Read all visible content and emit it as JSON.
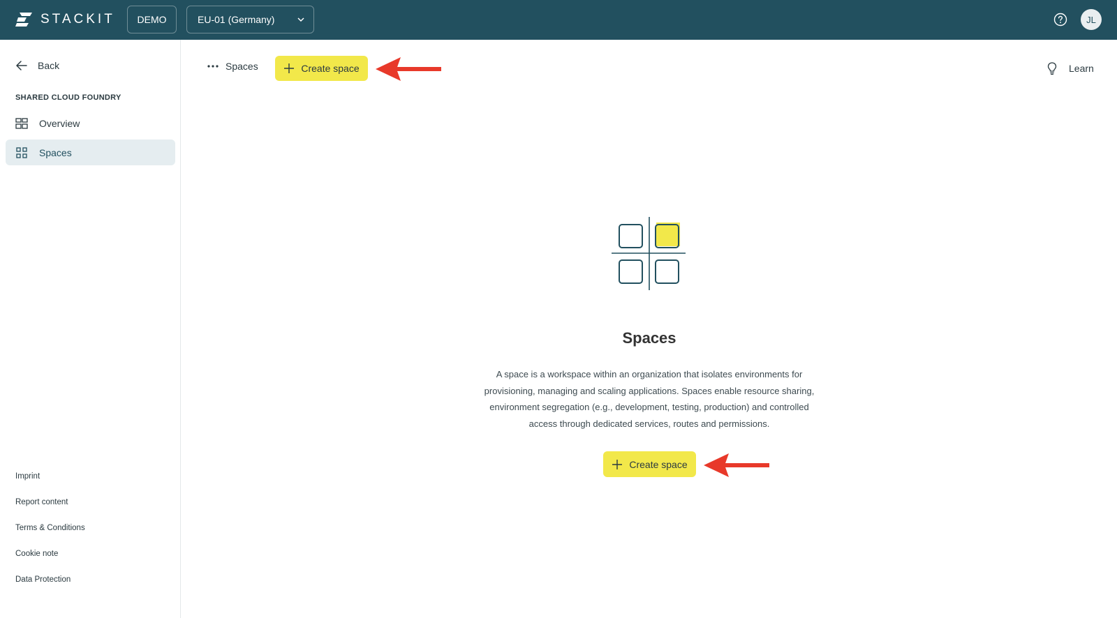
{
  "topbar": {
    "logo_text": "STACKIT",
    "org_label": "DEMO",
    "region_label": "EU-01 (Germany)",
    "help_icon": "help-circle-icon",
    "avatar_initials": "JL"
  },
  "sidebar": {
    "back_label": "Back",
    "section_title": "SHARED CLOUD FOUNDRY",
    "items": [
      {
        "label": "Overview",
        "icon": "dashboard-icon",
        "active": false
      },
      {
        "label": "Spaces",
        "icon": "spaces-grid-icon",
        "active": true
      }
    ],
    "footer_links": [
      "Imprint",
      "Report content",
      "Terms & Conditions",
      "Cookie note",
      "Data Protection"
    ]
  },
  "header": {
    "breadcrumb_label": "Spaces",
    "create_button_label": "Create space",
    "learn_label": "Learn"
  },
  "empty_state": {
    "title": "Spaces",
    "description": "A space is a workspace within an organization that isolates environments for provisioning, managing and scaling applications. Spaces enable resource sharing, environment segregation (e.g., development, testing, production) and controlled access through dedicated services, routes and permissions.",
    "button_label": "Create space"
  },
  "colors": {
    "topbar": "#22505f",
    "accent_yellow": "#f2e84a",
    "annotation_arrow": "#e8392a",
    "active_nav_bg": "#e5edf0"
  }
}
